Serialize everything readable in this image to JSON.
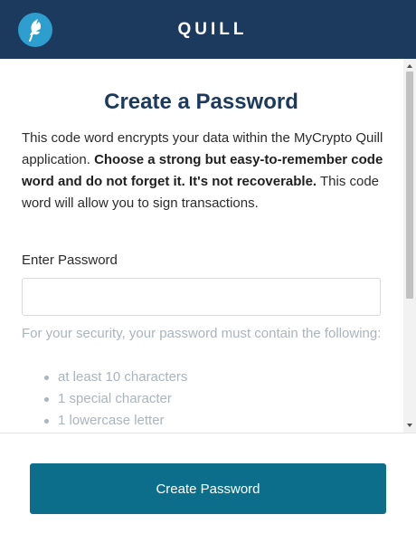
{
  "header": {
    "brand": "QUILL",
    "logo_icon": "quill-feather-icon"
  },
  "main": {
    "title": "Create a Password",
    "intro": {
      "part1": "This code word encrypts your data within the MyCrypto Quill application. ",
      "bold": "Choose a strong but easy-to-remember code word and do not forget it. It's not recoverable.",
      "part2": " This code word will allow you to sign transactions."
    },
    "password_label": "Enter Password",
    "password_value": "",
    "requirements_intro": "For your security, your password must contain the following:",
    "requirements": [
      "at least 10 characters",
      "1 special character",
      "1 lowercase letter"
    ]
  },
  "footer": {
    "button_label": "Create Password"
  },
  "colors": {
    "header_bg": "#1b3a5e",
    "logo_bg": "#2e9ecf",
    "title": "#1b3a5e",
    "button_bg": "#0c6e8a",
    "muted_text": "#aab4bd"
  }
}
